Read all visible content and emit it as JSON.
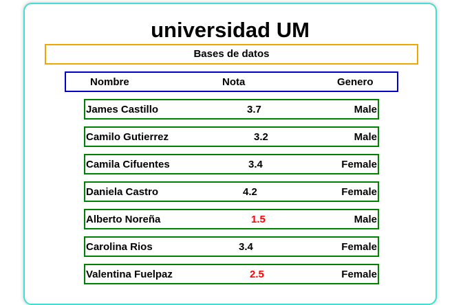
{
  "title": "universidad UM",
  "subtitle": "Bases de datos",
  "columns": {
    "name": "Nombre",
    "grade": "Nota",
    "gender": "Genero"
  },
  "colors": {
    "card_border": "#40e0d0",
    "subtitle_border": "#f0a500",
    "header_border": "#0000cc",
    "row_border": "#008000",
    "failing_grade": "#ff0000"
  },
  "students": [
    {
      "name": "James Castillo",
      "grade": "3.7",
      "gender": "Male"
    },
    {
      "name": "Camilo Gutierrez",
      "grade": "3.2",
      "gender": "Male"
    },
    {
      "name": "Camila Cifuentes",
      "grade": "3.4",
      "gender": "Female"
    },
    {
      "name": "Daniela Castro",
      "grade": "4.2",
      "gender": "Female"
    },
    {
      "name": "Alberto Noreña",
      "grade": "1.5",
      "gender": "Male",
      "failing": true
    },
    {
      "name": "Carolina Rios",
      "grade": "3.4",
      "gender": "Female"
    },
    {
      "name": "Valentina Fuelpaz",
      "grade": "2.5",
      "gender": "Female",
      "failing": true
    }
  ]
}
